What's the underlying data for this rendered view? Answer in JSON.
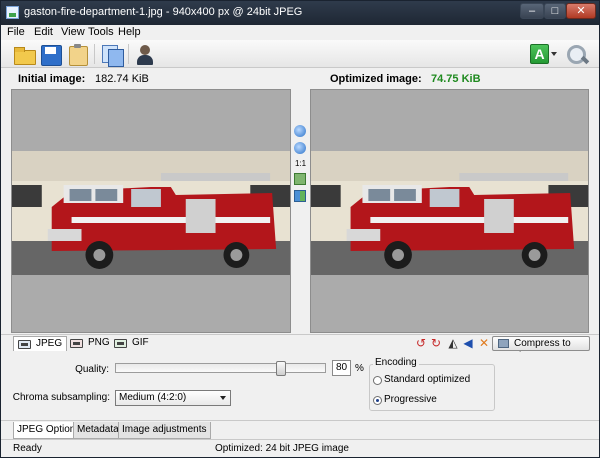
{
  "window": {
    "title": "gaston-fire-department-1.jpg - 940x400 px @ 24bit JPEG",
    "minimize": "–",
    "maximize": "□",
    "close": "✕"
  },
  "menu": [
    "File",
    "Edit",
    "View",
    "Tools",
    "Help"
  ],
  "toolbar": {
    "icons": [
      "folder-open-icon",
      "save-icon",
      "clipboard-icon",
      "copy-icon",
      "user-icon"
    ],
    "right_badge": "A"
  },
  "images": {
    "initial_label": "Initial image:",
    "initial_size": "182.74 KiB",
    "optimized_label": "Optimized image:",
    "optimized_size": "74.75 KiB"
  },
  "zoom": {
    "actual_size": "1:1"
  },
  "formats": {
    "tabs": [
      "JPEG",
      "PNG",
      "GIF"
    ],
    "active": "JPEG",
    "compress_button": "Compress to size"
  },
  "options": {
    "quality_label": "Quality:",
    "quality_value": "80",
    "quality_percent": 80,
    "percent_sign": "%",
    "chroma_label": "Chroma subsampling:",
    "chroma_value": "Medium (4:2:0)",
    "encoding_title": "Encoding",
    "encoding_options": [
      "Standard optimized",
      "Progressive"
    ],
    "encoding_selected": "Progressive"
  },
  "bottom_tabs": [
    "JPEG Options",
    "Metadata",
    "Image adjustments"
  ],
  "status": {
    "left": "Ready",
    "center": "Optimized: 24 bit JPEG image"
  },
  "colors": {
    "optimized_size": "#1f8a1f",
    "truck_red": "#b3161b",
    "accent_green": "#2ea43d"
  }
}
